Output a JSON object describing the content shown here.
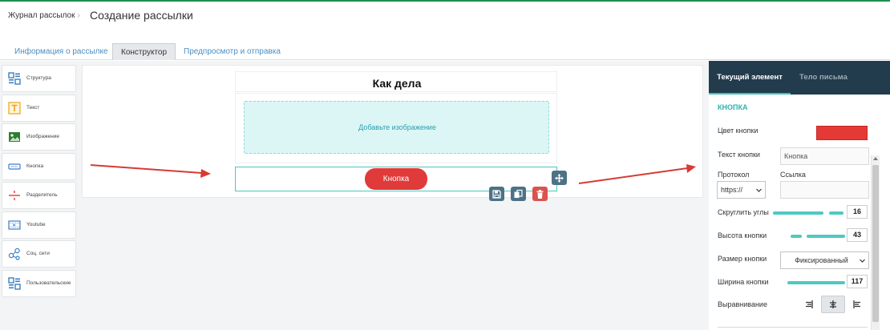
{
  "header": {
    "breadcrumb": "Журнал рассылок",
    "breadcrumb_separator": "›",
    "title": "Создание рассылки"
  },
  "tabs": [
    {
      "label": "Информация о рассылке",
      "active": false
    },
    {
      "label": "Конструктор",
      "active": true
    },
    {
      "label": "Предпросмотр и отправка",
      "active": false
    }
  ],
  "blocks": [
    {
      "label": "Структура",
      "icon": "structure-icon"
    },
    {
      "label": "Текст",
      "icon": "text-icon"
    },
    {
      "label": "Изображение",
      "icon": "image-icon"
    },
    {
      "label": "Кнопка",
      "icon": "button-icon"
    },
    {
      "label": "Разделитель",
      "icon": "divider-icon"
    },
    {
      "label": "Youtube",
      "icon": "youtube-icon"
    },
    {
      "label": "Соц. сети",
      "icon": "social-icon"
    },
    {
      "label": "Пользовательские",
      "icon": "custom-icon"
    }
  ],
  "canvas": {
    "title": "Как дела",
    "image_placeholder": "Добавьте изображение",
    "button_label": "Кнопка"
  },
  "panel": {
    "tabs": [
      "Текущий элемент",
      "Тело письма"
    ],
    "section_title": "КНОПКА",
    "color_label": "Цвет кнопки",
    "button_color": "#e53935",
    "text_label": "Текст кнопки",
    "text_value": "Кнопка",
    "protocol_label": "Протокол",
    "protocol_value": "https://",
    "link_label": "Ссылка",
    "link_value": "",
    "round_label": "Скруглить углы",
    "round_value": "16",
    "height_label": "Высота кнопки",
    "height_value": "43",
    "size_label": "Размер кнопки",
    "size_value": "Фиксированный",
    "width_label": "Ширина кнопки",
    "width_value": "117",
    "align_label": "Выравнивание",
    "align_options": [
      "right-align-icon",
      "center-align-icon",
      "left-align-icon"
    ],
    "align_selected": "center"
  },
  "colors": {
    "accent": "#3ec4be",
    "panel_header": "#233c4d",
    "button_red": "#e03a3a",
    "arrow_red": "#d63b35"
  }
}
